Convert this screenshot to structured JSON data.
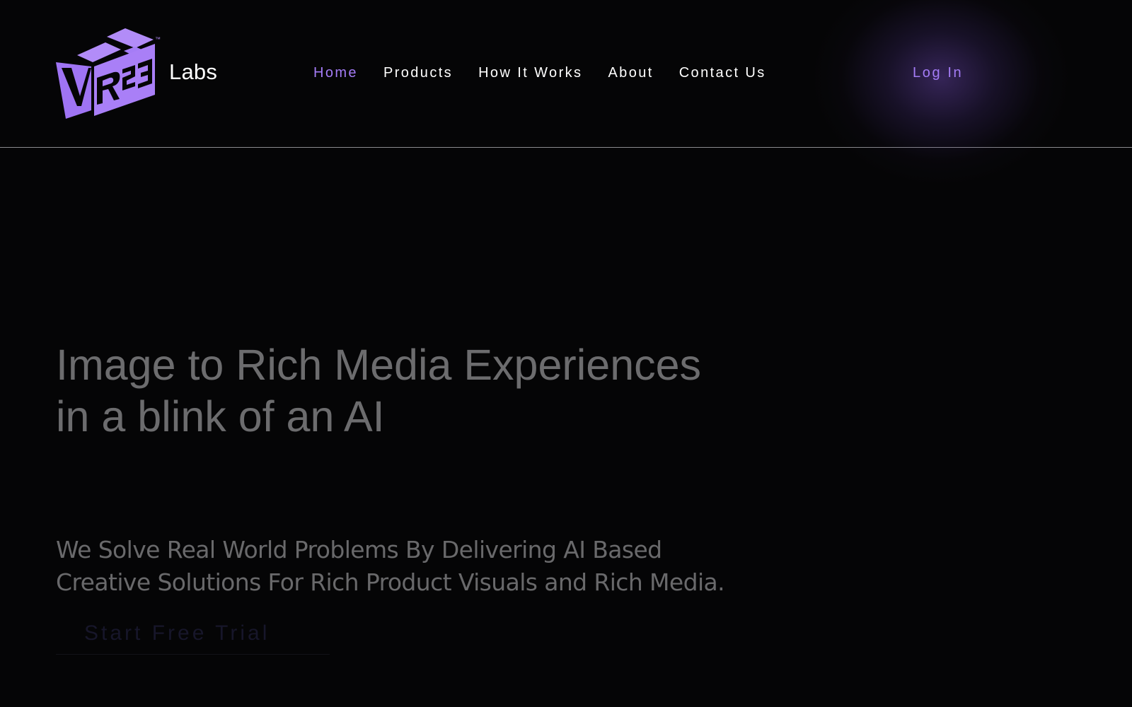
{
  "brand": {
    "logo_icon": "r23-cube-logo-icon",
    "logo_mark": "R23",
    "logo_tm": "™",
    "name": "Labs"
  },
  "nav": {
    "items": [
      {
        "label": "Home",
        "active": true
      },
      {
        "label": "Products",
        "active": false
      },
      {
        "label": "How It Works",
        "active": false
      },
      {
        "label": "About",
        "active": false
      },
      {
        "label": "Contact Us",
        "active": false
      }
    ],
    "login_label": "Log In"
  },
  "hero": {
    "title_line1": "Image to Rich Media Experiences",
    "title_line2": "in a blink of an AI",
    "subtitle_line1": "We Solve Real World Problems By Delivering AI Based",
    "subtitle_line2": "Creative Solutions For Rich Product Visuals and Rich Media.",
    "cta_label": "Start Free Trial"
  },
  "colors": {
    "background": "#050506",
    "accent": "#a47cf6",
    "nav_text": "#ffffff",
    "hero_text": "#6c6c6e"
  }
}
